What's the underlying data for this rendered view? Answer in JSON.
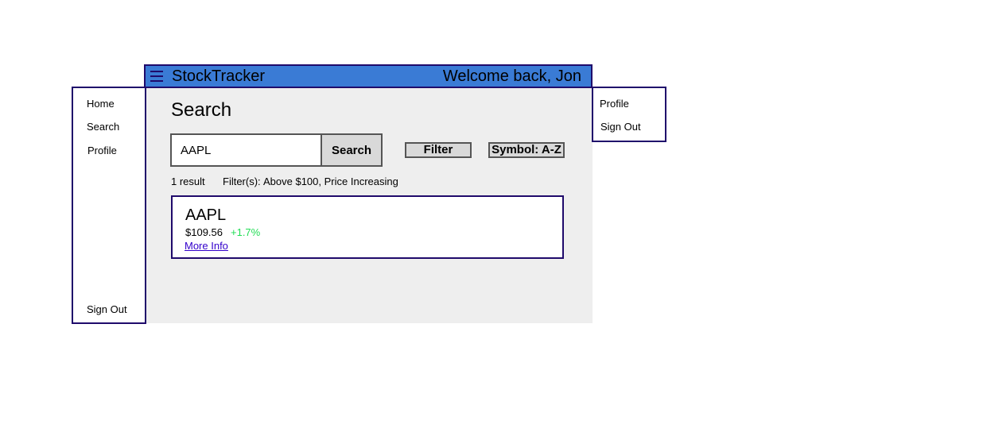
{
  "header": {
    "title": "StockTracker",
    "welcome": "Welcome back, Jon"
  },
  "sidebar": {
    "items": [
      {
        "label": "Home"
      },
      {
        "label": "Search"
      },
      {
        "label": "Profile"
      }
    ],
    "signout_label": "Sign Out"
  },
  "user_menu": {
    "items": [
      {
        "label": "Profile"
      },
      {
        "label": "Sign Out"
      }
    ]
  },
  "main": {
    "title": "Search",
    "search": {
      "value": "AAPL",
      "button_label": "Search"
    },
    "filter_label": "Filter",
    "sort_label": "Symbol: A-Z",
    "result_count": "1 result",
    "filters_label": "Filter(s):",
    "filters_value": "Above $100, Price Increasing",
    "results": [
      {
        "symbol": "AAPL",
        "price": "$109.56",
        "change": "+1.7%",
        "link_label": "More Info"
      }
    ]
  },
  "colors": {
    "header_bg": "#3a7bd5",
    "border": "#1f0a6b",
    "positive_change": "#22dd55",
    "link": "#3300cc",
    "content_bg": "#eeeeee"
  },
  "icons": {
    "menu": "hamburger-menu-icon"
  }
}
